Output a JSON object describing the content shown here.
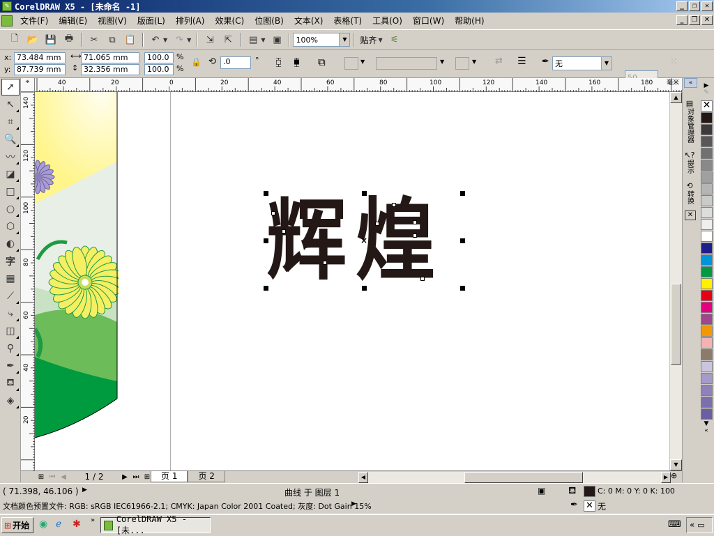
{
  "window": {
    "title": "CorelDRAW X5 - [未命名 -1]"
  },
  "menu": [
    "文件(F)",
    "编辑(E)",
    "视图(V)",
    "版面(L)",
    "排列(A)",
    "效果(C)",
    "位图(B)",
    "文本(X)",
    "表格(T)",
    "工具(O)",
    "窗口(W)",
    "帮助(H)"
  ],
  "toolbar": {
    "zoom_value": "100%",
    "snap_label": "贴齐"
  },
  "propbar": {
    "x_label": "x:",
    "x_value": "73.484 mm",
    "y_label": "y:",
    "y_value": "87.739 mm",
    "w_value": "71.065 mm",
    "h_value": "32.356 mm",
    "scale_x": "100.0",
    "scale_y": "100.0",
    "percent": "%",
    "rotation": ".0",
    "degree": "°",
    "outline_value": "无",
    "num_value": "50"
  },
  "ruler": {
    "top_ticks": [
      "40",
      "20",
      "0",
      "20",
      "40",
      "60",
      "80",
      "100",
      "120",
      "140",
      "160",
      "180"
    ],
    "unit": "毫米",
    "left_ticks": [
      "140",
      "120",
      "100",
      "80",
      "60",
      "40",
      "20"
    ]
  },
  "canvas": {
    "text": "辉煌"
  },
  "pages": {
    "counter": "1 / 2",
    "tabs": [
      "页 1",
      "页 2"
    ]
  },
  "dockers": [
    "对象管理器",
    "提示",
    "转换"
  ],
  "palette": [
    "#231815",
    "#3e3a39",
    "#595757",
    "#727171",
    "#898989",
    "#9fa0a0",
    "#b5b5b6",
    "#c9caca",
    "#dcdddd",
    "#efefef",
    "#ffffff",
    "#1d2088",
    "#0095d9",
    "#009944",
    "#fff100",
    "#e60012",
    "#e4007f",
    "#a0458e",
    "#f39800",
    "#f5b2b2",
    "#8c7b6b",
    "#c9c5e1",
    "#a59aca",
    "#8f82bc",
    "#7b6fb0",
    "#6a5fa3"
  ],
  "status": {
    "coords": "( 71.398, 46.106 )",
    "object_info": "曲线 于 图层 1",
    "fill_text": "C: 0 M: 0 Y: 0 K: 100",
    "outline_text": "无",
    "color_profile": "文档颜色预置文件: RGB: sRGB IEC61966-2.1; CMYK: Japan Color 2001 Coated; 灰度: Dot Gain 15%"
  },
  "taskbar": {
    "start_label": "开始",
    "task_label": "CorelDRAW X5 - [未..."
  }
}
